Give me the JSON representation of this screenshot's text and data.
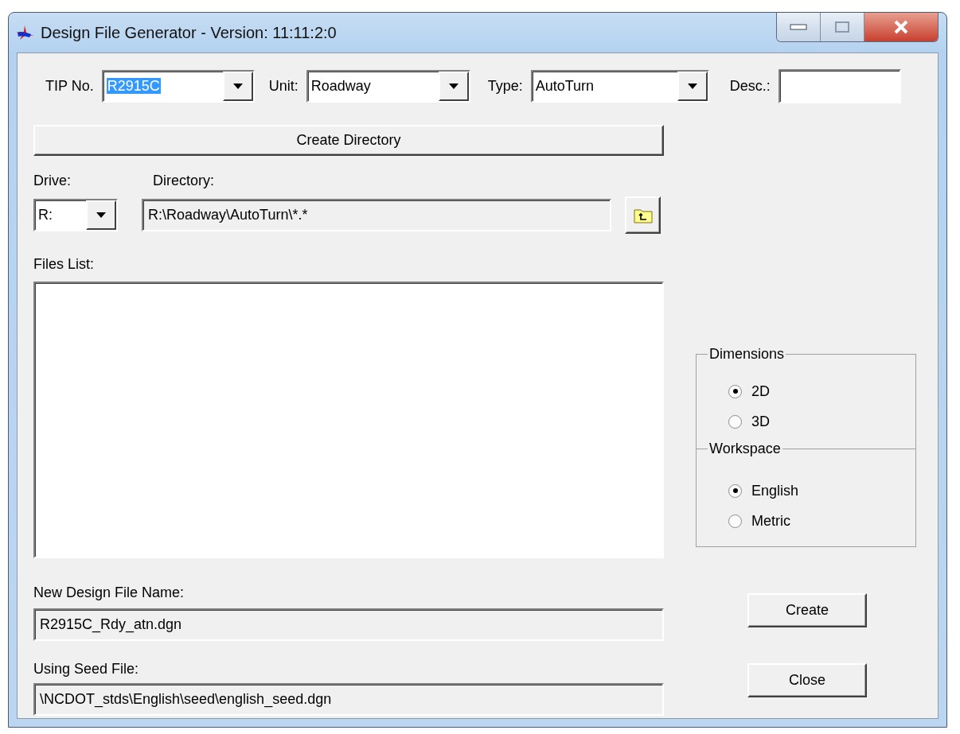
{
  "window": {
    "title": "Design File Generator - Version: 11:11:2:0"
  },
  "top_fields": [
    {
      "kind": "combo",
      "label": "TIP No.",
      "value": "R2915C",
      "highlighted": true
    },
    {
      "kind": "combo",
      "label": "Unit:",
      "value": "Roadway",
      "highlighted": false
    },
    {
      "kind": "combo",
      "label": "Type:",
      "value": "AutoTurn",
      "highlighted": false
    },
    {
      "kind": "text",
      "label": "Desc.:"
    }
  ],
  "create_directory_button": "Create Directory",
  "drive": {
    "label": "Drive:",
    "value": "R:"
  },
  "directory": {
    "label": "Directory:",
    "value": "R:\\Roadway\\AutoTurn\\*.*"
  },
  "files_list": {
    "label": "Files List:"
  },
  "groups": [
    {
      "title": "Dimensions",
      "options": [
        {
          "label": "2D",
          "selected": true
        },
        {
          "label": "3D",
          "selected": false
        }
      ]
    },
    {
      "title": "Workspace",
      "options": [
        {
          "label": "English",
          "selected": true
        },
        {
          "label": "Metric",
          "selected": false
        }
      ]
    }
  ],
  "new_file": {
    "label": "New Design File Name:",
    "value": "R2915C_Rdy_atn.dgn"
  },
  "seed_file": {
    "label": "Using Seed File:",
    "value": "\\NCDOT_stds\\English\\seed\\english_seed.dgn"
  },
  "buttons": [
    "Create",
    "Close"
  ]
}
